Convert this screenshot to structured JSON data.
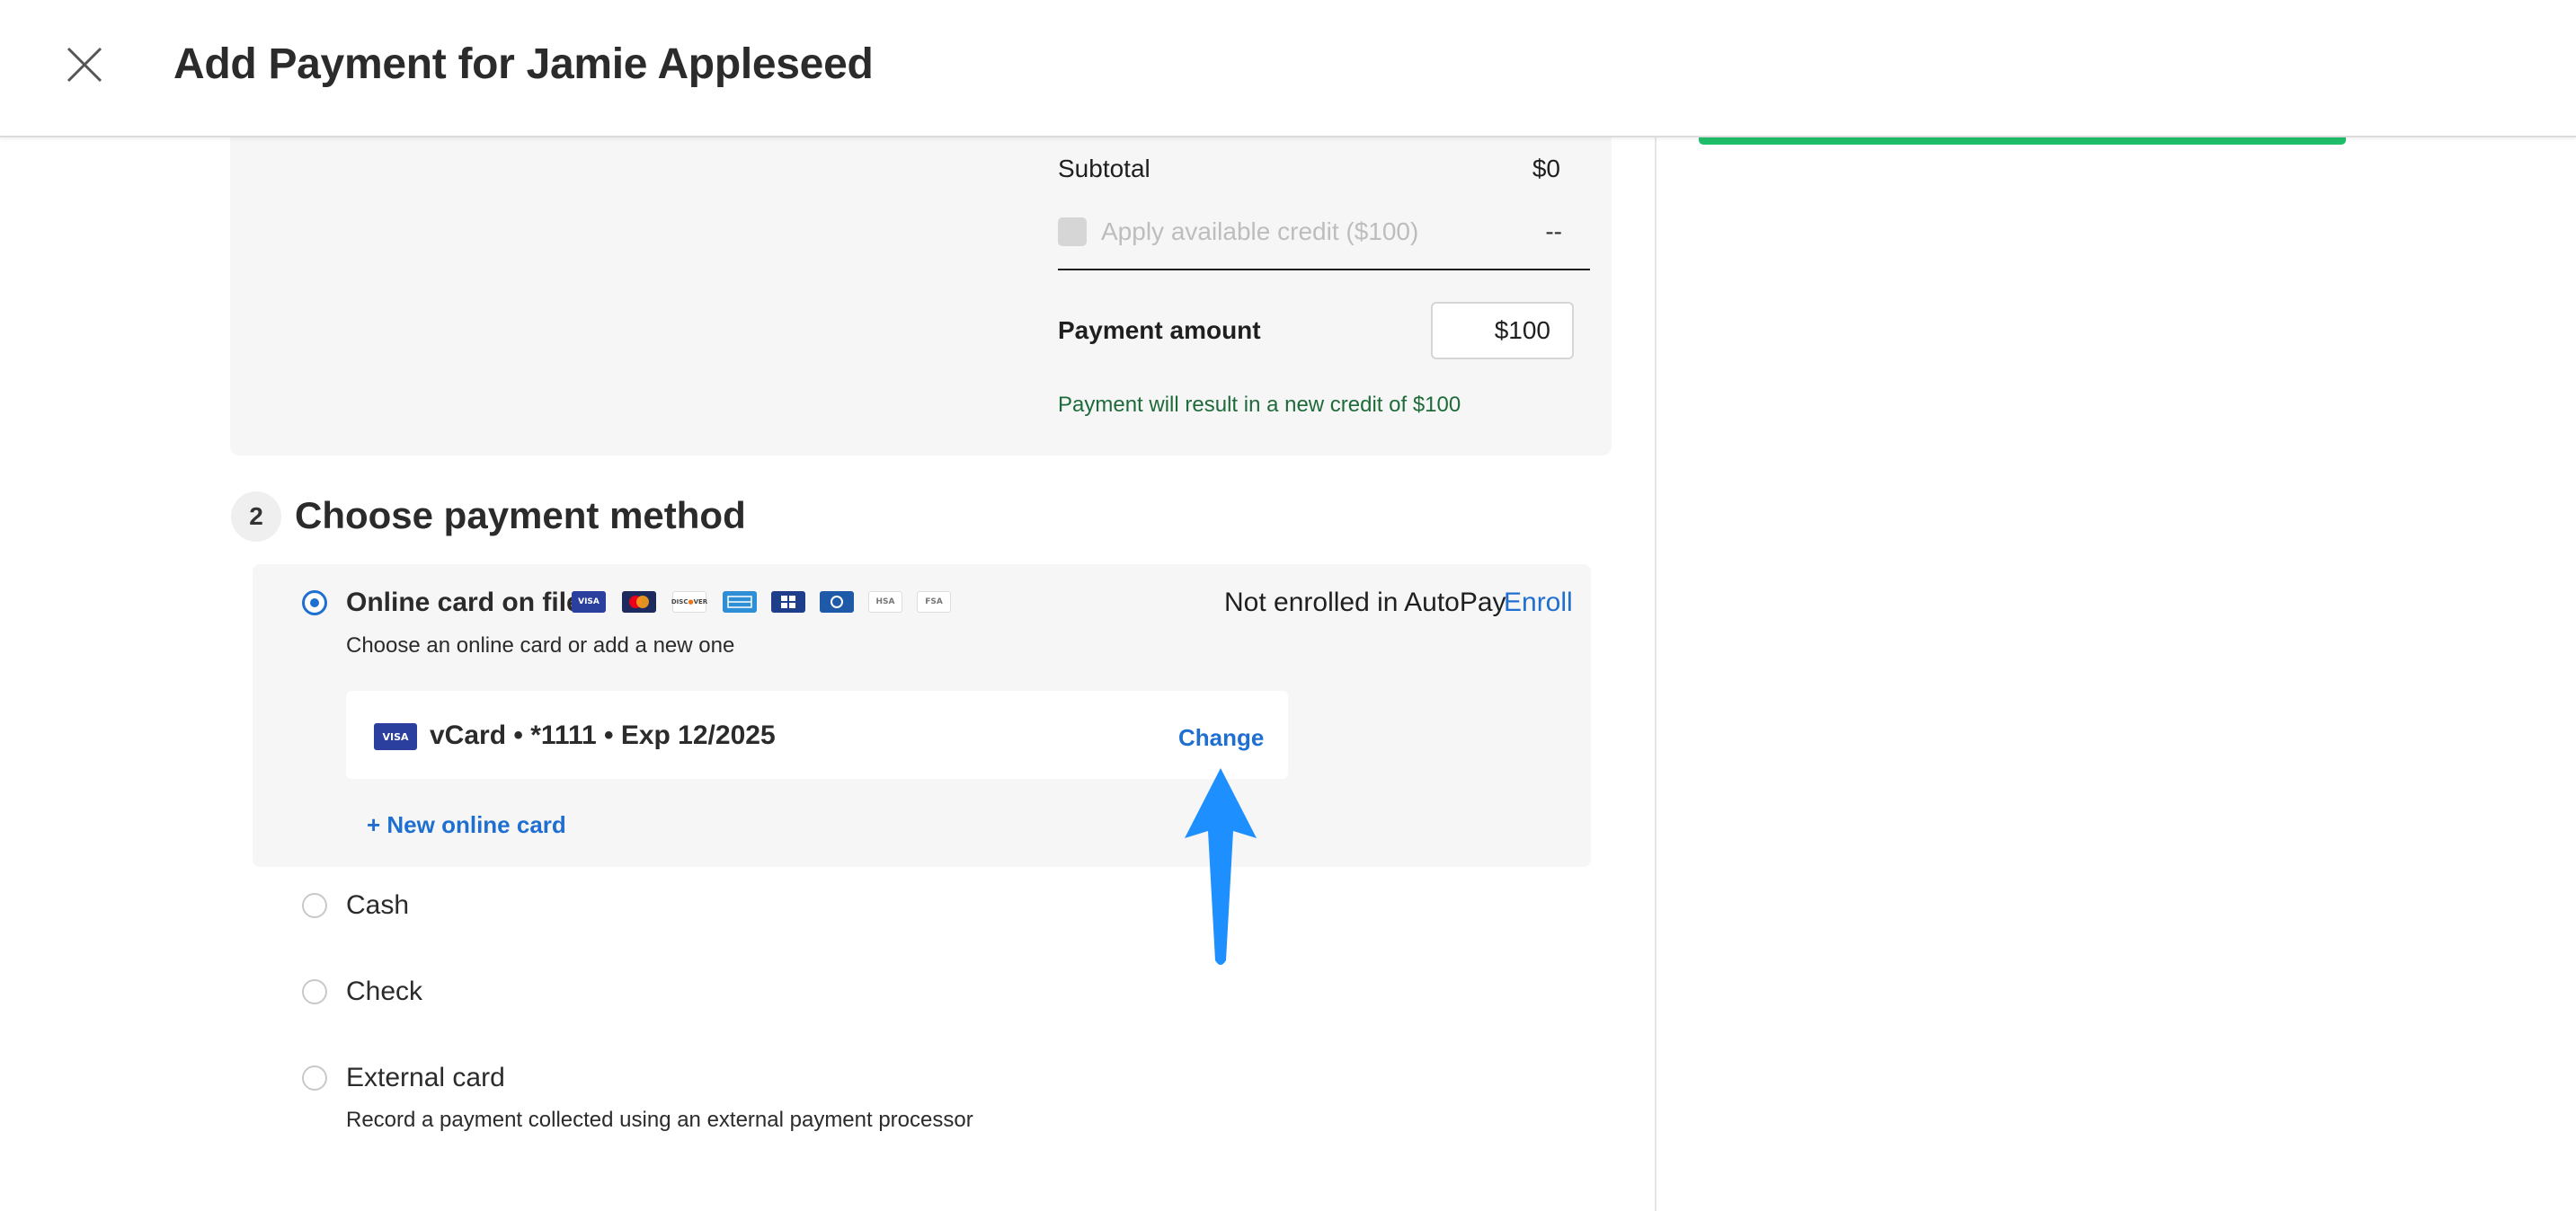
{
  "header": {
    "title": "Add Payment for Jamie Appleseed",
    "close_icon": "close-icon"
  },
  "summary": {
    "subtotal_label": "Subtotal",
    "subtotal_value": "$0",
    "credit_label": "Apply available credit ($100)",
    "credit_value": "--",
    "payment_amount_label": "Payment amount",
    "payment_amount_value": "$100",
    "credit_note": "Payment will result in a new credit of $100"
  },
  "step": {
    "number": "2",
    "title": "Choose payment method"
  },
  "methods": {
    "online": {
      "label": "Online card on file",
      "sub": "Choose an online card or add a new one",
      "selected": true,
      "card_icons": [
        "VISA",
        "mastercard",
        "DISCOVER",
        "AMEX",
        "jcb",
        "diners",
        "HSA",
        "FSA"
      ],
      "autopay_text": "Not enrolled in AutoPay",
      "enroll_label": "Enroll",
      "card": {
        "brand": "VISA",
        "label": "vCard • *1111 • Exp 12/2025",
        "change_label": "Change"
      },
      "new_card_label": "+ New online card"
    },
    "cash": {
      "label": "Cash"
    },
    "check": {
      "label": "Check"
    },
    "external": {
      "label": "External card",
      "sub": "Record a payment collected using an external payment processor"
    }
  },
  "colors": {
    "accent": "#1f6fd1",
    "success_bar": "#1fbf6a",
    "credit_note": "#1e6b3a",
    "annotation_arrow": "#1e8fff"
  }
}
